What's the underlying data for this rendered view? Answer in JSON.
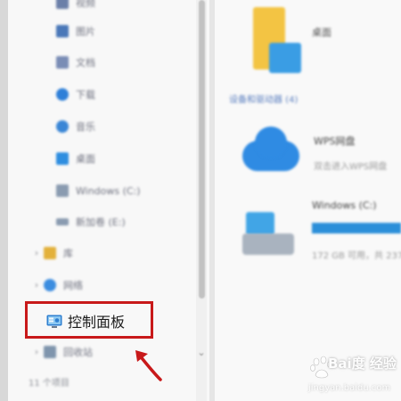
{
  "nav": {
    "items": [
      {
        "label": "视频",
        "icon": "video-icon",
        "color": "#6b7fa8"
      },
      {
        "label": "图片",
        "icon": "pictures-icon",
        "color": "#4a78b8"
      },
      {
        "label": "文档",
        "icon": "documents-icon",
        "color": "#7a8db5"
      },
      {
        "label": "下载",
        "icon": "downloads-icon",
        "color": "#2e7fd8"
      },
      {
        "label": "音乐",
        "icon": "music-icon",
        "color": "#3a86d6"
      },
      {
        "label": "桌面",
        "icon": "desktop-icon",
        "color": "#2e8ee0"
      },
      {
        "label": "Windows (C:)",
        "icon": "windows-drive-icon",
        "color": "#8a9bb0"
      },
      {
        "label": "新加卷 (E:)",
        "icon": "local-drive-icon",
        "color": "#8a9bb0"
      },
      {
        "label": "库",
        "icon": "libraries-icon",
        "color": "#e3b13b"
      },
      {
        "label": "网络",
        "icon": "network-icon",
        "color": "#3c8de0"
      },
      {
        "label": "回收站",
        "icon": "recycle-bin-icon",
        "color": "#7f95ad"
      }
    ],
    "control_panel_label": "控制面板",
    "status_count": "11 个项目"
  },
  "content": {
    "desktop_label": "桌面",
    "group_header": "设备和驱动器 (4)",
    "wps_title": "WPS网盘",
    "wps_sub": "双击进入WPS网盘",
    "drive_title": "Windows (C:)",
    "drive_sub": "172 GB 可用，共 237 GB"
  },
  "watermark": {
    "brand": "Bai度 经验",
    "url": "jingyan.baidu.com"
  },
  "colors": {
    "highlight": "#c8191a",
    "accent": "#2b8fd9"
  }
}
